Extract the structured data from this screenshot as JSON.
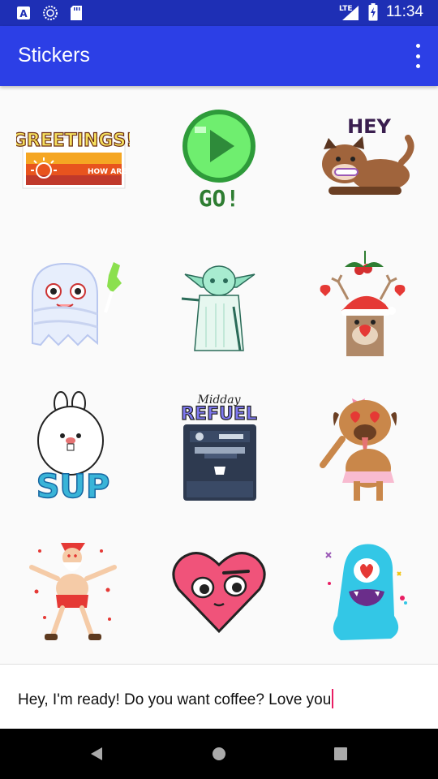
{
  "status_bar": {
    "time": "11:34",
    "network": "LTE",
    "left_icons": [
      "a-notification-icon",
      "sync-icon",
      "sd-card-icon"
    ],
    "right_icons": [
      "signal-icon",
      "battery-charging-icon"
    ]
  },
  "app_bar": {
    "title": "Stickers",
    "overflow_icon": "more-vert-icon"
  },
  "stickers": [
    {
      "name": "greetings",
      "text": "GREETINGS!",
      "subtext": "HOW ARE YOU?"
    },
    {
      "name": "go",
      "text": "GO!"
    },
    {
      "name": "hey-dog",
      "text": "HEY"
    },
    {
      "name": "ghost",
      "text": ""
    },
    {
      "name": "yoda",
      "text": ""
    },
    {
      "name": "reindeer",
      "text": ""
    },
    {
      "name": "sup-bunny",
      "text": "SUP"
    },
    {
      "name": "midday-refuel",
      "text": "REFUEL",
      "subtext": "Midday"
    },
    {
      "name": "pug",
      "text": ""
    },
    {
      "name": "santa",
      "text": ""
    },
    {
      "name": "heart",
      "text": ""
    },
    {
      "name": "blue-monster",
      "text": ""
    }
  ],
  "composer": {
    "value": "Hey, I'm ready! Do you want coffee? Love you"
  },
  "nav_bar": {
    "buttons": [
      "back-icon",
      "home-icon",
      "recents-icon"
    ]
  },
  "colors": {
    "status_bar": "#1e2fb5",
    "app_bar": "#2c3fe6",
    "caret": "#e91e63"
  }
}
